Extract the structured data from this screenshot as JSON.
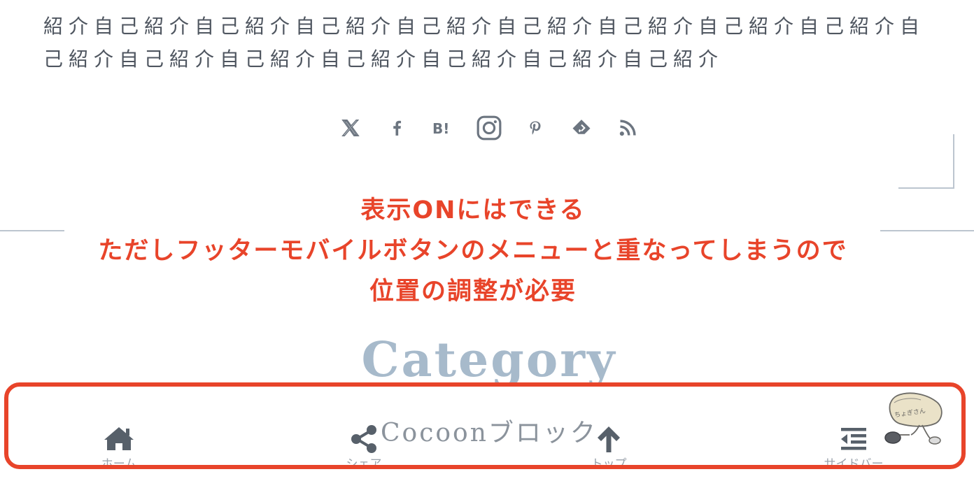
{
  "profile": {
    "intro_text": "紹介自己紹介自己紹介自己紹介自己紹介自己紹介自己紹介自己紹介自己紹介自己紹介自己紹介自己紹介自己紹介自己紹介自己紹介自己紹介"
  },
  "social_buttons": [
    {
      "icon": "x-icon"
    },
    {
      "icon": "facebook-icon"
    },
    {
      "icon": "hatena-bookmark-icon"
    },
    {
      "icon": "instagram-icon"
    },
    {
      "icon": "pinterest-icon"
    },
    {
      "icon": "feedly-icon"
    },
    {
      "icon": "rss-icon"
    }
  ],
  "annotation": {
    "line1": "表示ONにはできる",
    "line2": "ただしフッターモバイルボタンのメニューと重なってしまうので",
    "line3": "位置の調整が必要"
  },
  "category": {
    "heading": "Category",
    "first_item": "Cocoonブロック"
  },
  "mobile_footer": {
    "items": [
      {
        "label": "ホーム",
        "icon": "home-icon"
      },
      {
        "label": "シェア",
        "icon": "share-icon"
      },
      {
        "label": "トップ",
        "icon": "arrow-up-icon"
      },
      {
        "label": "サイドバー",
        "icon": "sidebar-menu-icon"
      }
    ]
  },
  "colors": {
    "annotation": "#e8442a",
    "heading": "#a7bacb",
    "icon": "#57606a"
  }
}
